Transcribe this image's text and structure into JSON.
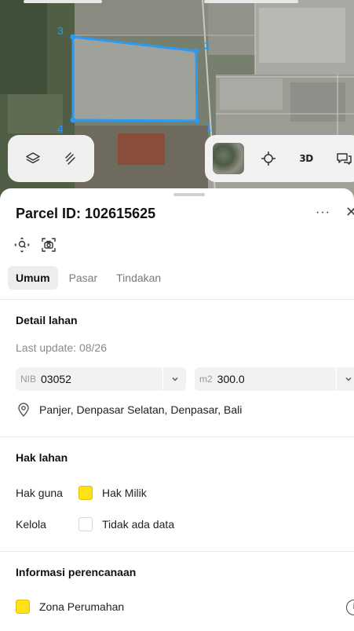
{
  "map": {
    "vertex_labels": [
      "3",
      "2",
      "4",
      "1"
    ],
    "polygon_color": "#2b9af3",
    "view_mode_label": "3D",
    "icons": {
      "layers": "layers-icon",
      "draw": "draw-icon",
      "basemap": "basemap-thumbnail",
      "locate": "crosshair-icon",
      "feedback": "chat-icon"
    }
  },
  "sheet": {
    "title": "Parcel ID: 102615625",
    "more_label": "···",
    "close_label": "✕",
    "tabs": [
      {
        "label": "Umum",
        "active": true
      },
      {
        "label": "Pasar",
        "active": false
      },
      {
        "label": "Tindakan",
        "active": false
      }
    ],
    "detail": {
      "title": "Detail lahan",
      "last_update": "Last update: 08/26",
      "nib_prefix": "NIB",
      "nib_value": "03052",
      "area_prefix": "m2",
      "area_value": "300.0",
      "address": "Panjer, Denpasar Selatan, Denpasar, Bali"
    },
    "rights": {
      "title": "Hak lahan",
      "rows": [
        {
          "label": "Hak guna",
          "value": "Hak Milik",
          "swatch": "#ffe11a"
        },
        {
          "label": "Kelola",
          "value": "Tidak ada data",
          "swatch": "#ffffff"
        }
      ]
    },
    "planning": {
      "title": "Informasi perencanaan",
      "zone": "Zona Perumahan",
      "zone_color": "#ffe11a",
      "info_label": "i"
    }
  }
}
